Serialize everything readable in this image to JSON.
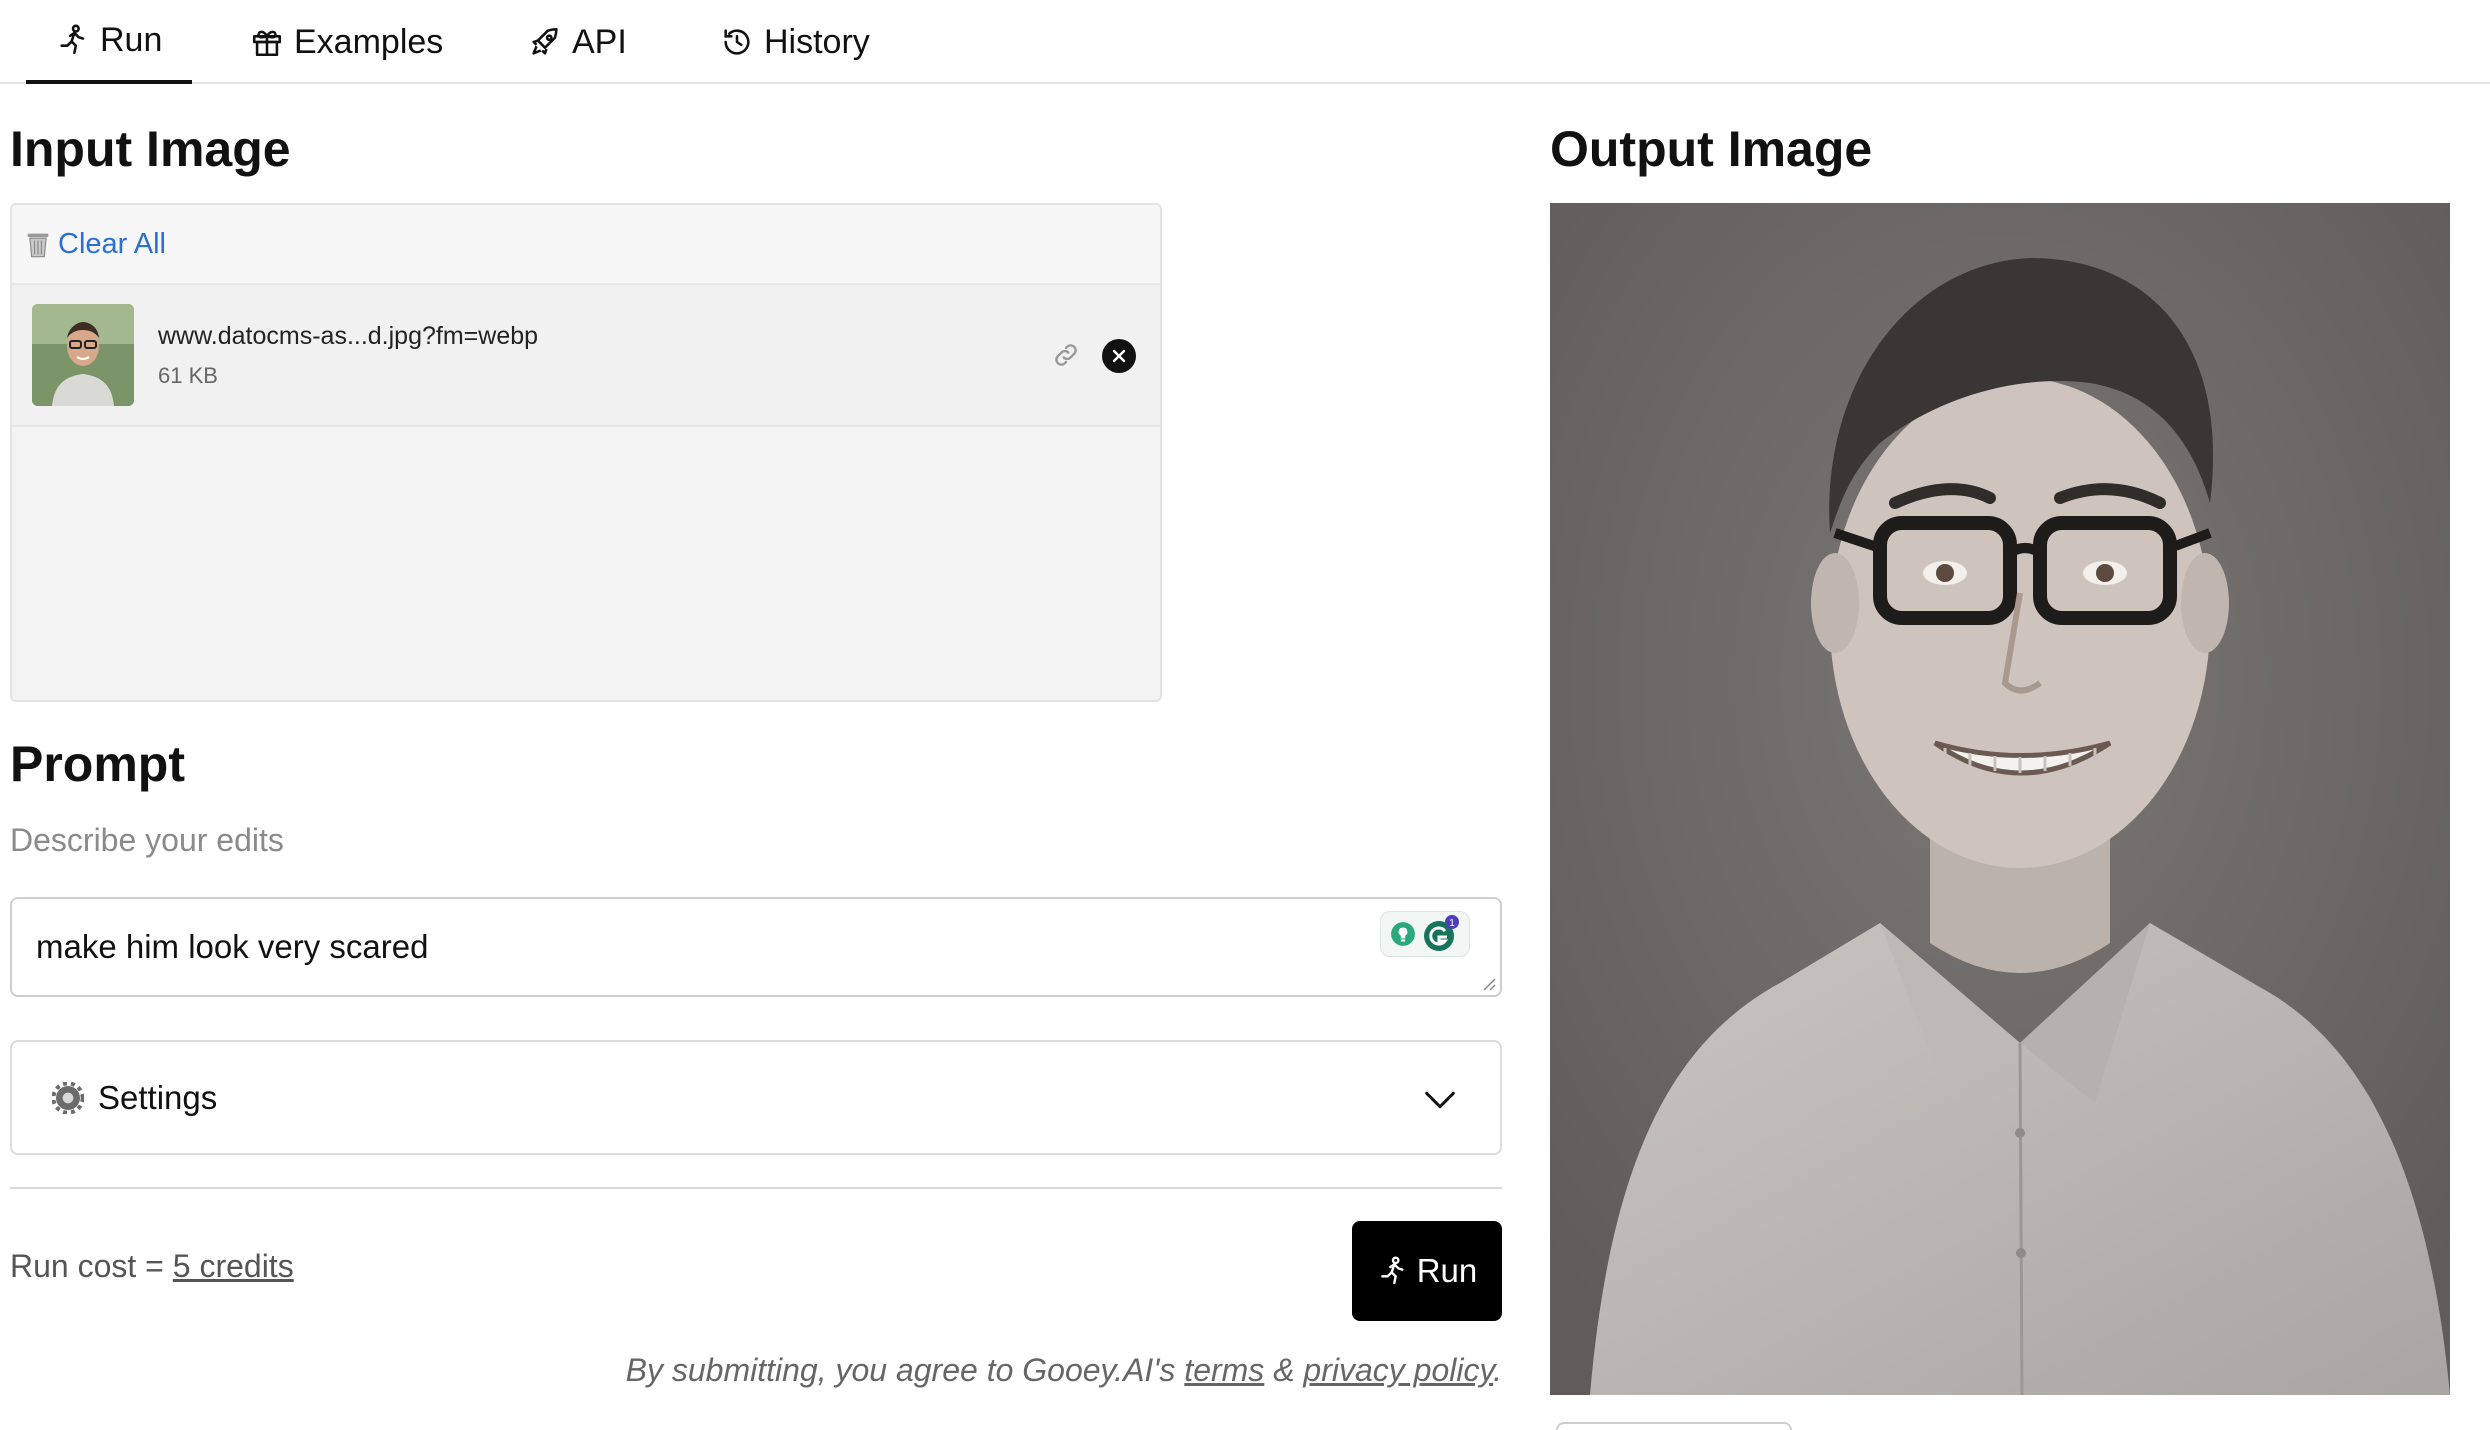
{
  "tabs": [
    {
      "label": "Run",
      "icon": "run-icon",
      "active": true
    },
    {
      "label": "Examples",
      "icon": "gift-icon"
    },
    {
      "label": "API",
      "icon": "rocket-icon"
    },
    {
      "label": "History",
      "icon": "history-icon"
    }
  ],
  "input": {
    "title": "Input Image",
    "clear_all": "Clear All",
    "file": {
      "name": "www.datocms-as...d.jpg?fm=webp",
      "size": "61 KB"
    }
  },
  "prompt": {
    "title": "Prompt",
    "helper": "Describe your edits",
    "value": "make him look very scared",
    "grammarly_badge": "1"
  },
  "settings": {
    "label": "Settings"
  },
  "cost": {
    "prefix": "Run cost = ",
    "credits": "5 credits"
  },
  "run_button": {
    "label": "Run"
  },
  "disclaimer": {
    "prefix": "By submitting, you agree to Gooey.AI's ",
    "terms": "terms",
    "amp": " & ",
    "privacy": "privacy policy",
    "suffix": "."
  },
  "output": {
    "title": "Output Image"
  },
  "colors": {
    "accent_link": "#2a6fd6",
    "run_button_bg": "#000000"
  }
}
